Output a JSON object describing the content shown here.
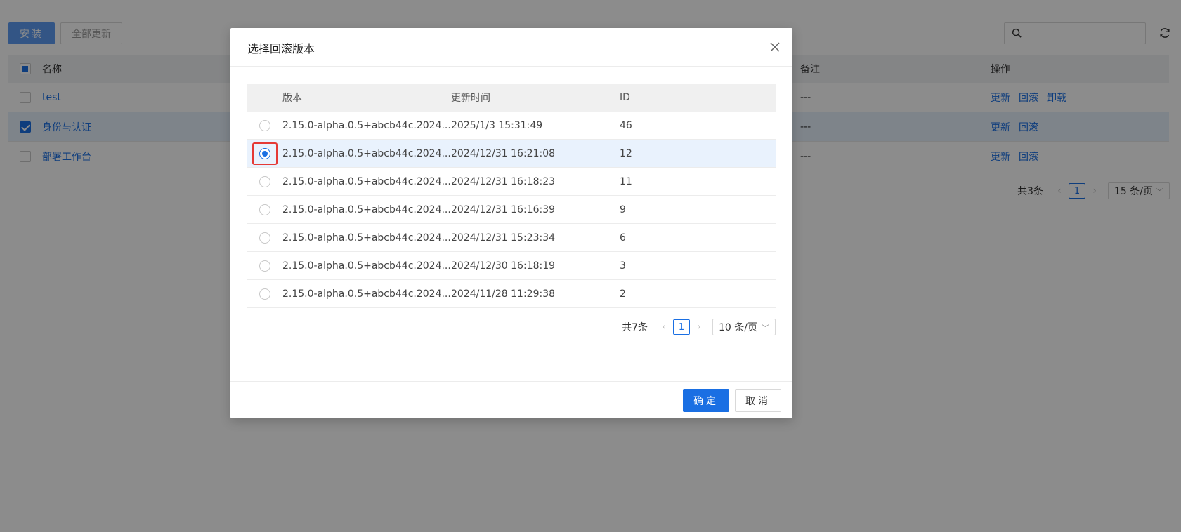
{
  "toolbar": {
    "install_label": "安装",
    "update_all_label": "全部更新",
    "search_placeholder": ""
  },
  "apps_table": {
    "headers": {
      "name": "名称",
      "remark": "备注",
      "actions": "操作"
    },
    "rows": [
      {
        "name": "test",
        "remark": "---",
        "actions": [
          "更新",
          "回滚",
          "卸载"
        ],
        "checked": false
      },
      {
        "name": "身份与认证",
        "remark": "---",
        "actions": [
          "更新",
          "回滚"
        ],
        "checked": true
      },
      {
        "name": "部署工作台",
        "remark": "---",
        "actions": [
          "更新",
          "回滚"
        ],
        "checked": false
      }
    ],
    "pagination": {
      "total": "共3条",
      "page": "1",
      "page_size": "15 条/页"
    }
  },
  "modal": {
    "title": "选择回滚版本",
    "headers": {
      "version": "版本",
      "updated_at": "更新时间",
      "id": "ID"
    },
    "rows": [
      {
        "version": "2.15.0-alpha.0.5+abcb44c.2024...",
        "updated_at": "2025/1/3 15:31:49",
        "id": "46",
        "selected": false
      },
      {
        "version": "2.15.0-alpha.0.5+abcb44c.2024...",
        "updated_at": "2024/12/31 16:21:08",
        "id": "12",
        "selected": true
      },
      {
        "version": "2.15.0-alpha.0.5+abcb44c.2024...",
        "updated_at": "2024/12/31 16:18:23",
        "id": "11",
        "selected": false
      },
      {
        "version": "2.15.0-alpha.0.5+abcb44c.2024...",
        "updated_at": "2024/12/31 16:16:39",
        "id": "9",
        "selected": false
      },
      {
        "version": "2.15.0-alpha.0.5+abcb44c.2024...",
        "updated_at": "2024/12/31 15:23:34",
        "id": "6",
        "selected": false
      },
      {
        "version": "2.15.0-alpha.0.5+abcb44c.2024...",
        "updated_at": "2024/12/30 16:18:19",
        "id": "3",
        "selected": false
      },
      {
        "version": "2.15.0-alpha.0.5+abcb44c.2024...",
        "updated_at": "2024/11/28 11:29:38",
        "id": "2",
        "selected": false
      }
    ],
    "pagination": {
      "total": "共7条",
      "page": "1",
      "page_size": "10 条/页"
    },
    "ok_label": "确定",
    "cancel_label": "取消"
  },
  "colors": {
    "primary": "#1a6fe3",
    "highlight": "#e53935",
    "mask": "rgba(0,0,0,0.45)"
  }
}
